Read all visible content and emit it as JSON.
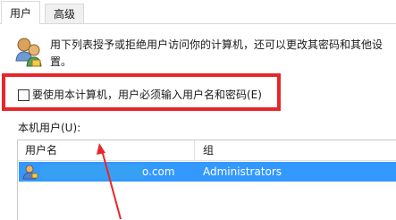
{
  "tabs": [
    {
      "label": "用户",
      "active": true
    },
    {
      "label": "高级",
      "active": false
    }
  ],
  "intro_text": "用下列表授予或拒绝用户访问你的计算机，还可以更改其密码和其他设置。",
  "require_login": {
    "label": "要使用本计算机，用户必须输入用户名和密码(E)",
    "checked": false
  },
  "users_list": {
    "label": "本机用户(U):",
    "columns": {
      "name": "用户名",
      "group": "组"
    },
    "rows": [
      {
        "name_visible_suffix": "o.com",
        "group": "Administrators",
        "selected": true
      }
    ]
  },
  "colors": {
    "highlight": "#e8262a",
    "selection": "#3399ff"
  },
  "icons": {
    "users": "users-icon",
    "user": "user-icon",
    "arrow": "red-arrow"
  }
}
